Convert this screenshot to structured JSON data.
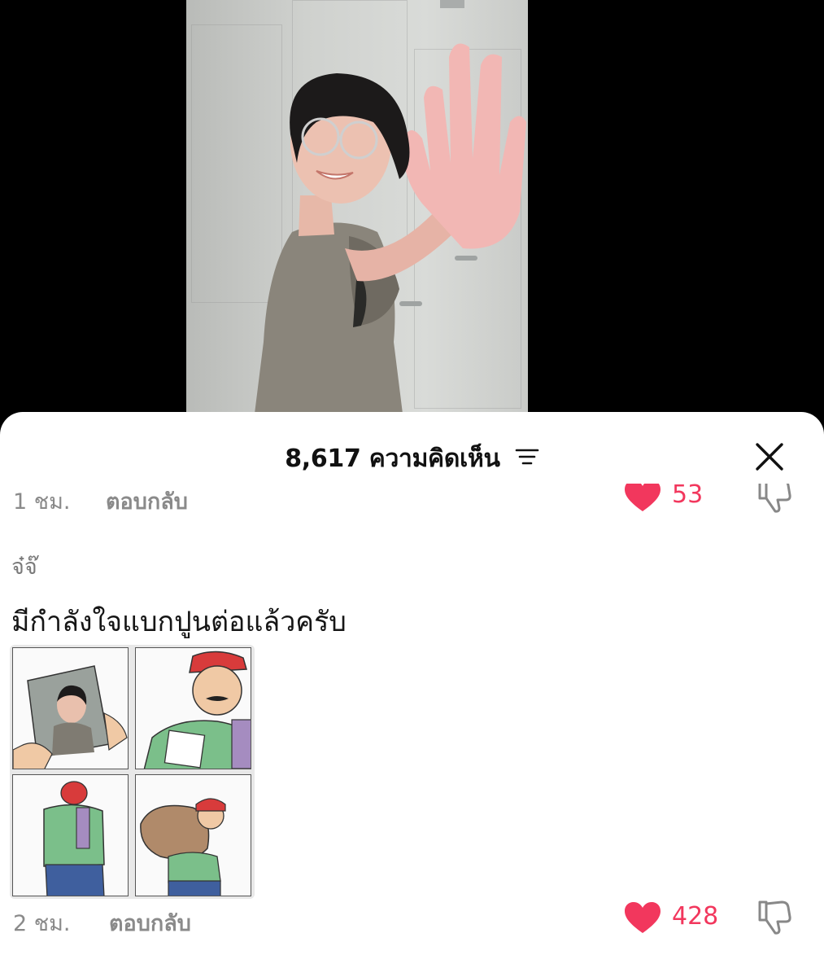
{
  "sheet": {
    "comment_count_title": "8,617 ความคิดเห็น"
  },
  "previous_comment": {
    "time": "1 ชม.",
    "reply_label": "ตอบกลับ",
    "likes": "53"
  },
  "comment": {
    "author": "จ๋จ๊",
    "text": "มีกำลังใจแบกปูนต่อแล้วครับ",
    "time": "2 ชม.",
    "reply_label": "ตอบกลับ",
    "likes": "428"
  },
  "colors": {
    "like_red": "#f2375d",
    "muted_text": "#8a8a8a",
    "sheet_bg": "#ffffff",
    "video_bg": "#000000"
  },
  "icons": {
    "filter": "sort-filter-icon",
    "close": "close-icon",
    "like": "heart-icon",
    "dislike": "thumbs-down-icon"
  }
}
